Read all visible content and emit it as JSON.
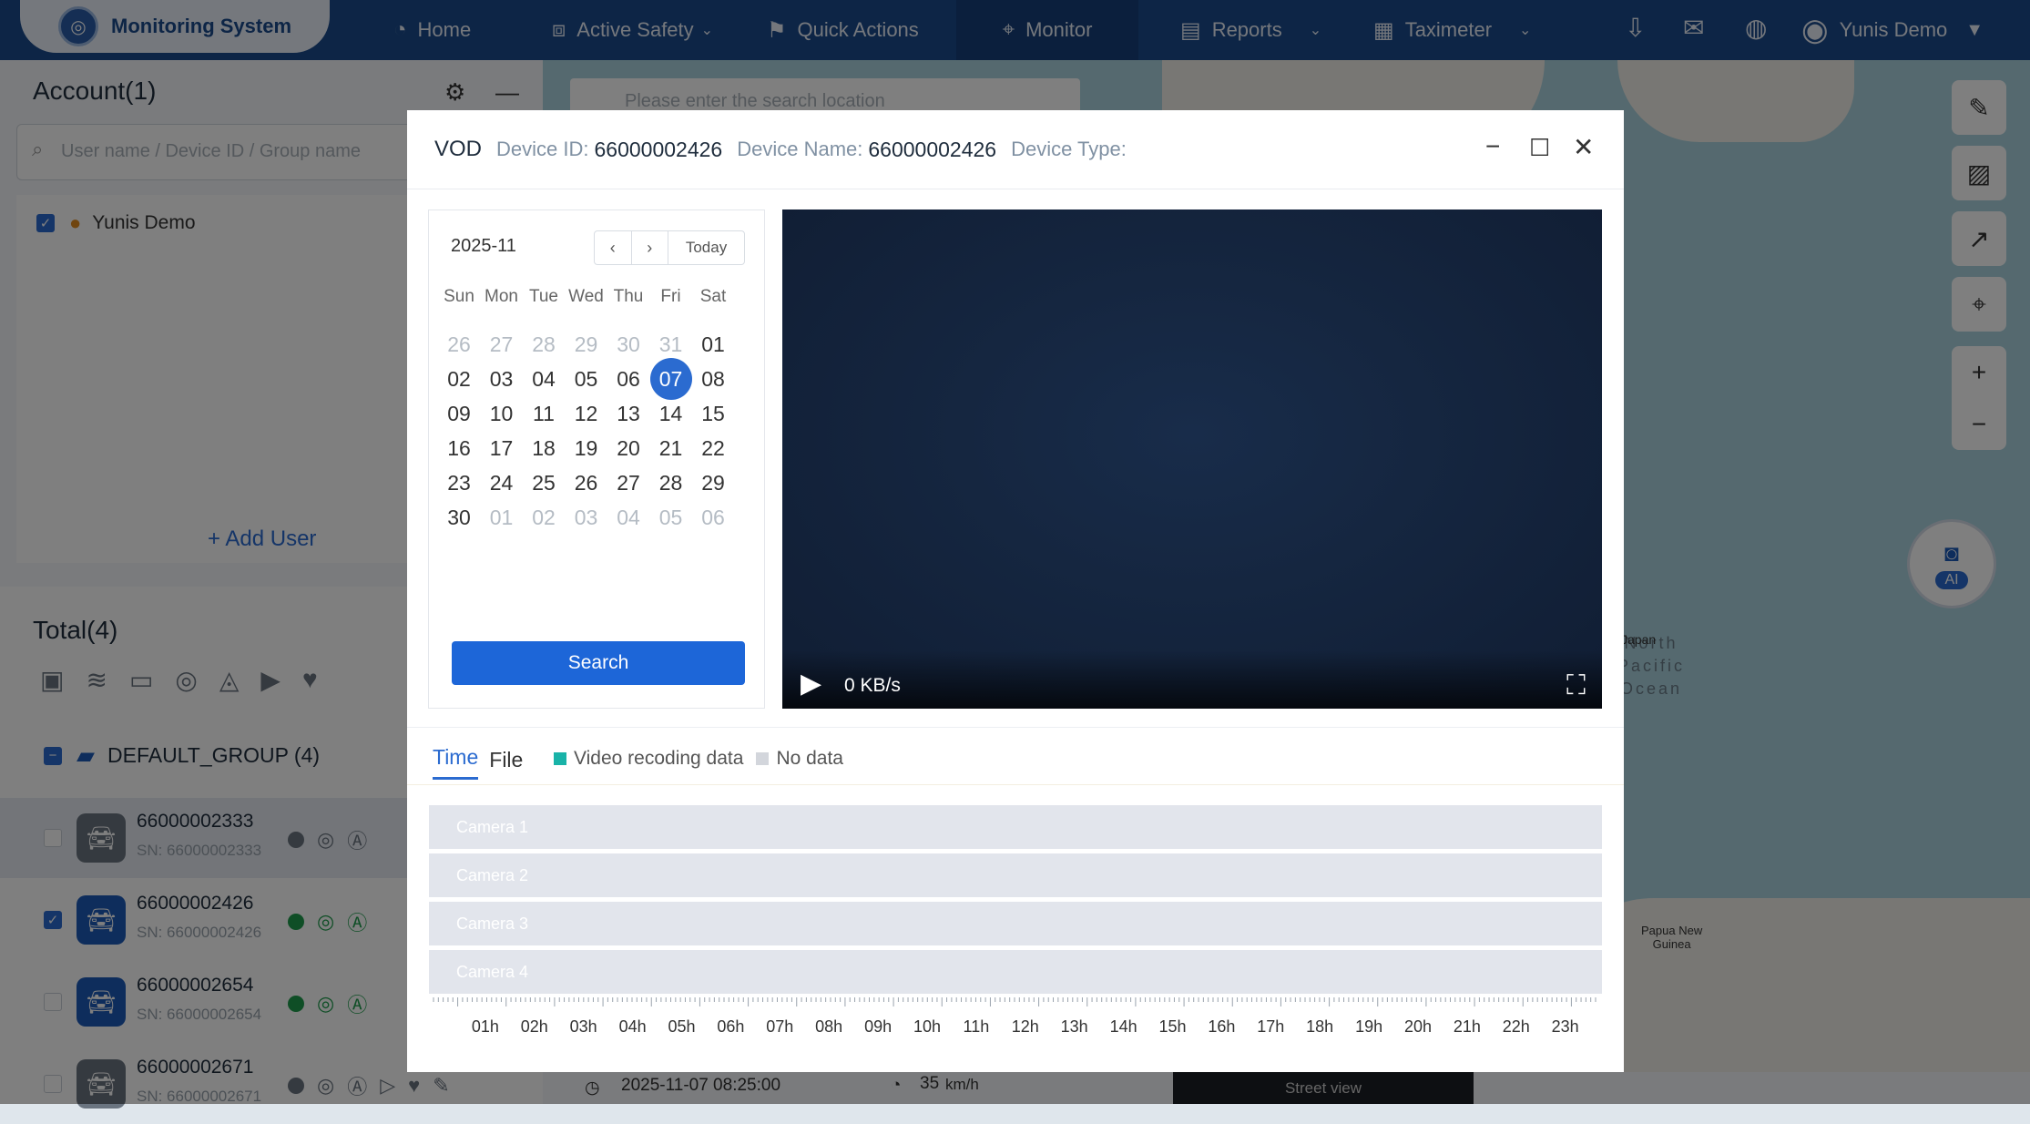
{
  "app": {
    "brand": "Monitoring System"
  },
  "nav": {
    "home": "Home",
    "active_safety": "Active Safety",
    "quick_actions": "Quick Actions",
    "monitor": "Monitor",
    "reports": "Reports",
    "taximeter": "Taximeter",
    "user": "Yunis Demo"
  },
  "account": {
    "title": "Account(1)",
    "search_placeholder": "User name / Device ID / Group name",
    "users": [
      "Yunis Demo"
    ],
    "add_user": "Add User"
  },
  "devices": {
    "total": "Total(4)",
    "group": "DEFAULT_GROUP (4)",
    "items": [
      {
        "name": "66000002333",
        "sn": "SN: 66000002333",
        "online": false,
        "checked": false
      },
      {
        "name": "66000002426",
        "sn": "SN: 66000002426",
        "online": true,
        "checked": true
      },
      {
        "name": "66000002654",
        "sn": "SN: 66000002654",
        "online": true,
        "checked": false
      },
      {
        "name": "66000002671",
        "sn": "SN: 66000002671",
        "online": false,
        "checked": false
      }
    ]
  },
  "map": {
    "search_placeholder": "Please enter the search location",
    "ocean_label": [
      "North",
      "Pacific",
      "Ocean"
    ],
    "japan": "Japan",
    "png": [
      "Papua New",
      "Guinea"
    ],
    "ai_label": "AI",
    "status_time": "2025-11-07 08:25:00",
    "speed": "35",
    "speed_unit": "km/h",
    "street_view": "Street view"
  },
  "vod": {
    "title": "VOD",
    "device_id_label": "Device ID:",
    "device_id": "66000002426",
    "device_name_label": "Device Name:",
    "device_name": "66000002426",
    "device_type_label": "Device Type:",
    "calendar": {
      "month": "2025-11",
      "today": "Today",
      "weekdays": [
        "Sun",
        "Mon",
        "Tue",
        "Wed",
        "Thu",
        "Fri",
        "Sat"
      ],
      "weeks": [
        [
          "26",
          "27",
          "28",
          "29",
          "30",
          "31",
          "01"
        ],
        [
          "02",
          "03",
          "04",
          "05",
          "06",
          "07",
          "08"
        ],
        [
          "09",
          "10",
          "11",
          "12",
          "13",
          "14",
          "15"
        ],
        [
          "16",
          "17",
          "18",
          "19",
          "20",
          "21",
          "22"
        ],
        [
          "23",
          "24",
          "25",
          "26",
          "27",
          "28",
          "29"
        ],
        [
          "30",
          "01",
          "02",
          "03",
          "04",
          "05",
          "06"
        ]
      ],
      "selected": "07"
    },
    "search_button": "Search",
    "player": {
      "rate": "0 KB/s"
    },
    "tabs": [
      "Time",
      "File"
    ],
    "legend": {
      "recording": "Video recoding data",
      "none": "No data"
    },
    "colors": {
      "recording": "#19b3a8",
      "none": "#d3d6dc",
      "accent": "#2b6bd0"
    },
    "cameras": [
      "Camera 1",
      "Camera 2",
      "Camera 3",
      "Camera 4"
    ],
    "hours": [
      "01h",
      "02h",
      "03h",
      "04h",
      "05h",
      "06h",
      "07h",
      "08h",
      "09h",
      "10h",
      "11h",
      "12h",
      "13h",
      "14h",
      "15h",
      "16h",
      "17h",
      "18h",
      "19h",
      "20h",
      "21h",
      "22h",
      "23h"
    ]
  }
}
